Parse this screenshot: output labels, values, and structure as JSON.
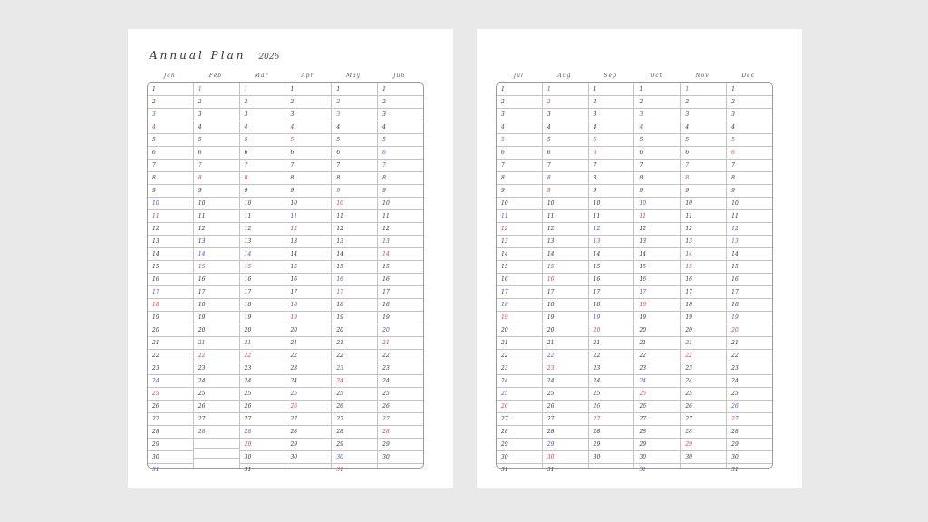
{
  "title": "Annual Plan",
  "year": "2026",
  "colors": {
    "weekday": "#333333",
    "sunday": "#d2374f",
    "saturday": "#4b4bc4"
  },
  "pages": [
    {
      "months": [
        {
          "label": "Jan",
          "days": 31,
          "first_weekday": 4
        },
        {
          "label": "Feb",
          "days": 28,
          "first_weekday": 0
        },
        {
          "label": "Mar",
          "days": 31,
          "first_weekday": 0
        },
        {
          "label": "Apr",
          "days": 30,
          "first_weekday": 3
        },
        {
          "label": "May",
          "days": 31,
          "first_weekday": 5
        },
        {
          "label": "Jun",
          "days": 30,
          "first_weekday": 1
        }
      ]
    },
    {
      "months": [
        {
          "label": "Jul",
          "days": 31,
          "first_weekday": 3
        },
        {
          "label": "Aug",
          "days": 31,
          "first_weekday": 6
        },
        {
          "label": "Sep",
          "days": 30,
          "first_weekday": 2
        },
        {
          "label": "Oct",
          "days": 31,
          "first_weekday": 4
        },
        {
          "label": "Nov",
          "days": 30,
          "first_weekday": 0
        },
        {
          "label": "Dec",
          "days": 31,
          "first_weekday": 2
        }
      ]
    }
  ]
}
